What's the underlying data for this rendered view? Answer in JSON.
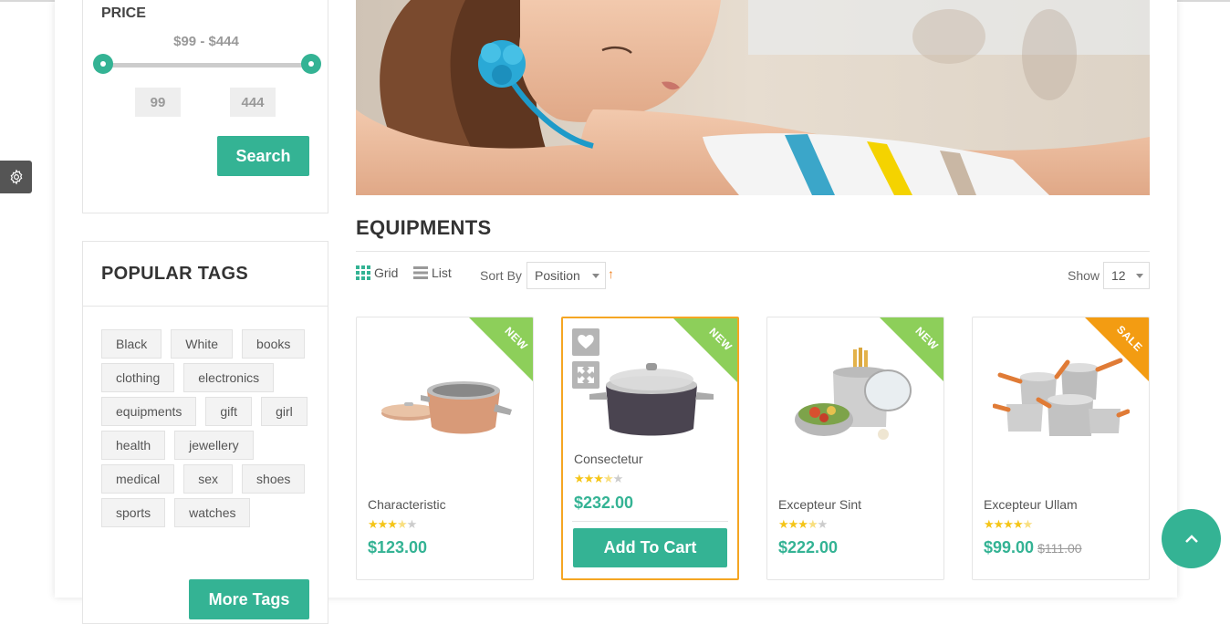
{
  "sidebar": {
    "price": {
      "title": "PRICE",
      "range": "$99 - $444",
      "min": "99",
      "max": "444",
      "search_label": "Search"
    },
    "tags": {
      "title": "POPULAR TAGS",
      "items": [
        "Black",
        "White",
        "books",
        "clothing",
        "electronics",
        "equipments",
        "gift",
        "girl",
        "health",
        "jewellery",
        "medical",
        "sex",
        "shoes",
        "sports",
        "watches"
      ],
      "more_label": "More Tags"
    }
  },
  "section": {
    "title": "EQUIPMENTS"
  },
  "toolbar": {
    "grid_label": "Grid",
    "list_label": "List",
    "sort_label": "Sort By",
    "sort_value": "Position",
    "sort_direction": "↑",
    "show_label": "Show",
    "show_value": "12"
  },
  "products": [
    {
      "name": "Characteristic",
      "price": "$123.00",
      "old_price": "",
      "rating": 3.5,
      "badge": "NEW"
    },
    {
      "name": "Consectetur",
      "price": "$232.00",
      "old_price": "",
      "rating": 3.5,
      "badge": "NEW",
      "cart_label": "Add To Cart"
    },
    {
      "name": "Excepteur Sint",
      "price": "$222.00",
      "old_price": "",
      "rating": 3.5,
      "badge": "NEW"
    },
    {
      "name": "Excepteur Ullam",
      "price": "$99.00",
      "old_price": "$111.00",
      "rating": 4.5,
      "badge": "SALE"
    }
  ],
  "colors": {
    "accent": "#34b394",
    "new_badge": "#8dcf5a",
    "sale_badge": "#f39c12",
    "active_border": "#f5a623",
    "star": "#f5c518"
  },
  "icons": [
    "gear-icon",
    "grid-icon",
    "list-icon",
    "heart-icon",
    "compare-icon",
    "chevron-up-icon"
  ]
}
